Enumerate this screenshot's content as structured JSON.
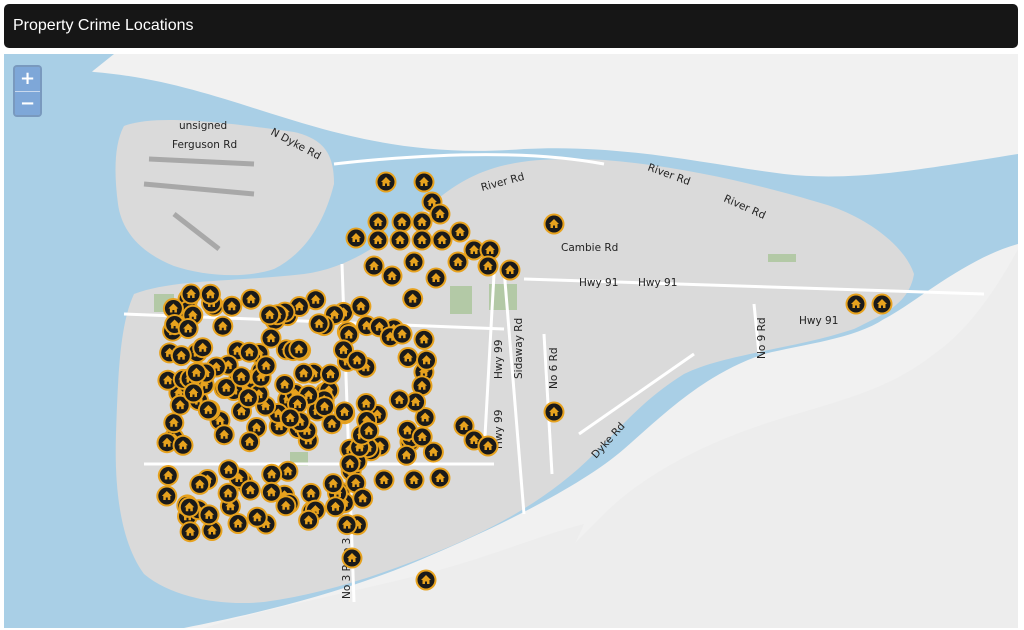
{
  "header": {
    "title": "Property Crime Locations"
  },
  "zoom": {
    "in_label": "+",
    "out_label": "−"
  },
  "colors": {
    "water": "#a9cfe6",
    "land": "#dadada",
    "park": "#b3c9a6",
    "marker": "#e7a21e",
    "marker_core": "#1a1a1a"
  },
  "road_labels": [
    "unsigned",
    "Ferguson Rd",
    "N Dyke Rd",
    "River Rd",
    "River Rd",
    "River Rd",
    "Cambie Rd",
    "Hwy 91",
    "Hwy 91",
    "Hwy 91",
    "Hwy 99",
    "Sidaway Rd",
    "No 6 Rd",
    "No 9 Rd",
    "Hwy 99",
    "Dyke Rd",
    "No 3 Rd",
    "No 3 Rd"
  ],
  "markers": {
    "icon": "house-break-in-icon",
    "count": 214
  }
}
